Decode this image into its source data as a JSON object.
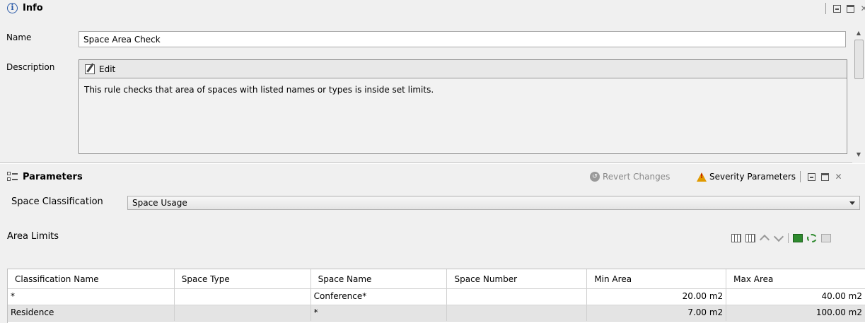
{
  "info": {
    "title": "Info",
    "name_label": "Name",
    "name_value": "Space Area Check",
    "description_label": "Description",
    "edit_label": "Edit",
    "description_text": "This rule checks that area of spaces with listed names or types is inside set limits."
  },
  "parameters": {
    "title": "Parameters",
    "revert_label": "Revert Changes",
    "severity_label": "Severity Parameters",
    "classification_label": "Space Classification",
    "classification_value": "Space Usage",
    "area_limits_label": "Area Limits",
    "table": {
      "columns": [
        "Classification Name",
        "Space Type",
        "Space Name",
        "Space Number",
        "Min Area",
        "Max Area"
      ],
      "rows": [
        [
          "*",
          "",
          "Conference*",
          "",
          "20.00 m2",
          "40.00 m2"
        ],
        [
          "Residence",
          "",
          "*",
          "",
          "7.00 m2",
          "100.00 m2"
        ]
      ]
    }
  }
}
